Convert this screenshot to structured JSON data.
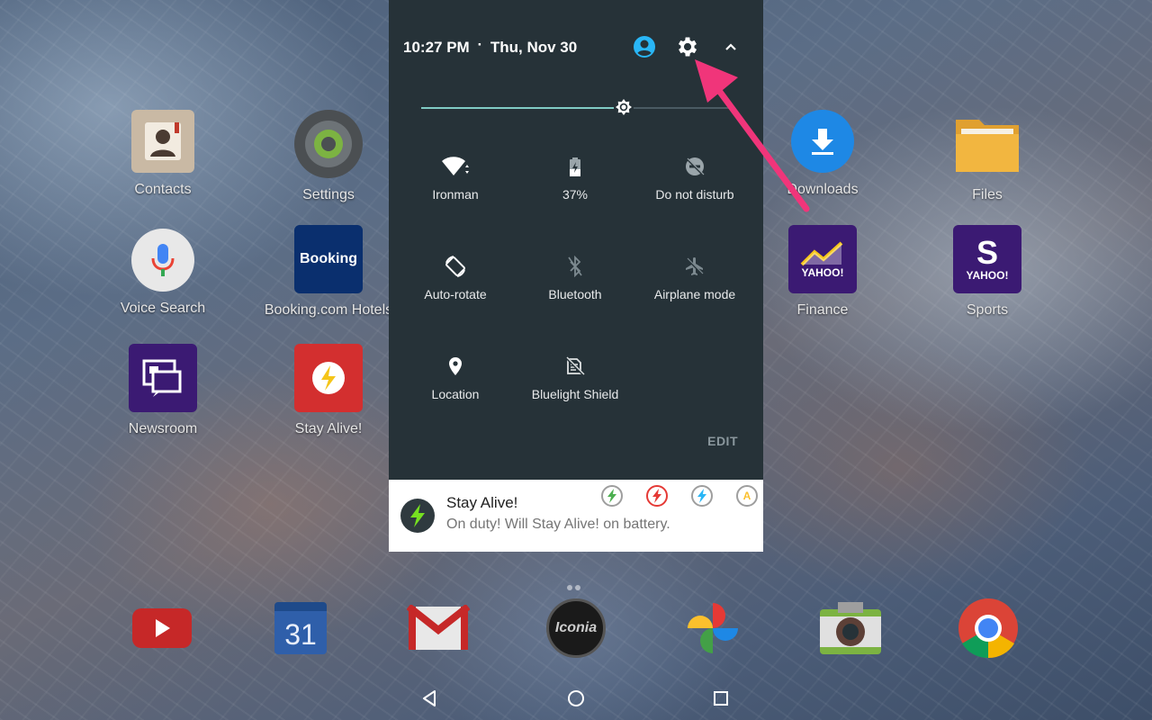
{
  "status_header": {
    "time": "10:27 PM",
    "separator": "·",
    "date": "Thu, Nov 30"
  },
  "brightness": {
    "level": 0.65
  },
  "tiles": [
    {
      "id": "wifi",
      "label": "Ironman",
      "icon": "wifi-icon"
    },
    {
      "id": "battery",
      "label": "37%",
      "icon": "battery-icon"
    },
    {
      "id": "dnd",
      "label": "Do not disturb",
      "icon": "do-not-disturb-icon"
    },
    {
      "id": "rotate",
      "label": "Auto-rotate",
      "icon": "auto-rotate-icon"
    },
    {
      "id": "bluetooth",
      "label": "Bluetooth",
      "icon": "bluetooth-icon"
    },
    {
      "id": "airplane",
      "label": "Airplane mode",
      "icon": "airplane-icon"
    },
    {
      "id": "location",
      "label": "Location",
      "icon": "location-icon"
    },
    {
      "id": "bluelight",
      "label": "Bluelight Shield",
      "icon": "bluelight-shield-icon"
    }
  ],
  "edit_label": "EDIT",
  "notification": {
    "title": "Stay Alive!",
    "text": "On duty! Will Stay Alive! on battery.",
    "actions": [
      {
        "icon": "bolt-green-icon",
        "color": "#4caf50"
      },
      {
        "icon": "bolt-red-icon",
        "color": "#e53935"
      },
      {
        "icon": "bolt-blue-icon",
        "color": "#29b6f6"
      },
      {
        "icon": "auto-icon",
        "label": "A",
        "color": "#fbc02d"
      }
    ]
  },
  "home_apps": {
    "left": [
      {
        "label": "Contacts",
        "icon": "contacts-icon"
      },
      {
        "label": "Settings",
        "icon": "settings-app-icon"
      },
      {
        "label": "Voice Search",
        "icon": "microphone-icon"
      },
      {
        "label": "Booking.com Hotels",
        "icon": "booking-icon",
        "text": "Booking"
      },
      {
        "label": "Newsroom",
        "icon": "newsroom-icon"
      },
      {
        "label": "Stay Alive!",
        "icon": "stay-alive-icon"
      }
    ],
    "right": [
      {
        "label": "Downloads",
        "icon": "download-icon"
      },
      {
        "label": "Files",
        "icon": "folder-icon"
      },
      {
        "label": "Finance",
        "icon": "yahoo-finance-icon",
        "text": "YAHOO!"
      },
      {
        "label": "Sports",
        "icon": "yahoo-sports-icon",
        "text": "YAHOO!"
      }
    ]
  },
  "dock": [
    {
      "icon": "youtube-icon"
    },
    {
      "icon": "calendar-icon",
      "text": "31"
    },
    {
      "icon": "gmail-icon"
    },
    {
      "icon": "iconia-icon",
      "text": "Iconia"
    },
    {
      "icon": "photos-icon"
    },
    {
      "icon": "camera-icon"
    },
    {
      "icon": "chrome-icon"
    }
  ],
  "colors": {
    "panel_bg": "#263238",
    "accent": "#80cbc4",
    "user_icon": "#29b6f6",
    "arrow": "#f0357a"
  }
}
